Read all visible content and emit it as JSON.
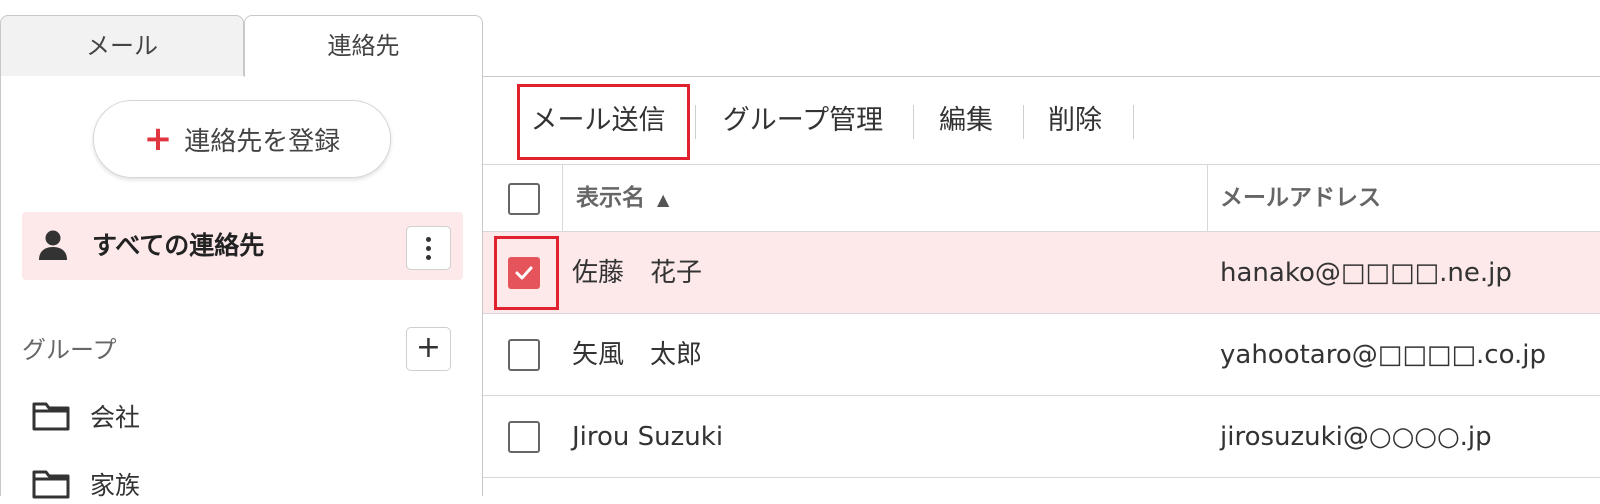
{
  "tabs": {
    "mail": "メール",
    "contacts": "連絡先"
  },
  "sidebar": {
    "add_contact_label": "連絡先を登録",
    "all_contacts_label": "すべての連絡先",
    "groups_heading": "グループ",
    "groups": [
      {
        "label": "会社"
      },
      {
        "label": "家族"
      }
    ]
  },
  "toolbar": {
    "send_mail": "メール送信",
    "group_manage": "グループ管理",
    "edit": "編集",
    "delete": "削除"
  },
  "table": {
    "columns": {
      "name": "表示名",
      "email": "メールアドレス"
    },
    "sort_indicator": "▲",
    "rows": [
      {
        "name": "佐藤　花子",
        "email": "hanako@□□□□.ne.jp",
        "selected": true
      },
      {
        "name": "矢風　太郎",
        "email": "yahootaro@□□□□.co.jp",
        "selected": false
      },
      {
        "name": "Jirou Suzuki",
        "email": "jirosuzuki@○○○○.jp",
        "selected": false
      }
    ]
  },
  "colors": {
    "accent": "#e0353f",
    "selected_row_bg": "#fde8ea",
    "highlight_border": "#e0222e"
  }
}
